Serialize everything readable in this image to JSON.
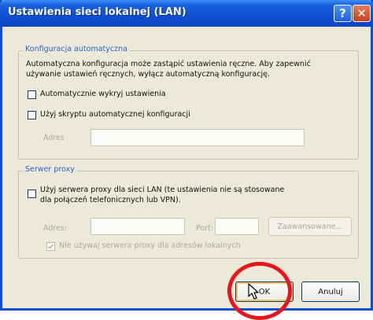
{
  "window": {
    "title": "Ustawienia sieci lokalnej (LAN)",
    "help_glyph": "?",
    "close_glyph": "✕"
  },
  "auto_config": {
    "legend": "Konfiguracja automatyczna",
    "description_line1": "Automatyczna konfiguracja może zastąpić ustawienia ręczne. Aby zapewnić",
    "description_line2": "używanie ustawień ręcznych, wyłącz automatyczną konfigurację.",
    "detect_label": "Automatycznie wykryj ustawienia",
    "detect_checked": false,
    "script_label": "Użyj skryptu automatycznej konfiguracji",
    "script_checked": false,
    "address_label": "Adres",
    "address_value": ""
  },
  "proxy": {
    "legend": "Serwer proxy",
    "use_proxy_line1": "Użyj serwera proxy dla sieci LAN (te ustawienia nie są stosowane",
    "use_proxy_line2": "dla połączeń telefonicznych lub VPN).",
    "use_proxy_checked": false,
    "address_label": "Adres:",
    "address_value": "",
    "port_label": "Port:",
    "port_value": "",
    "advanced_label": "Zaawansowane...",
    "bypass_label": "Nie używaj serwera proxy dla adresów lokalnych",
    "bypass_checked": true
  },
  "buttons": {
    "ok_label": "OK",
    "cancel_label": "Anuluj"
  },
  "colors": {
    "titlebar": "#0f4ed1",
    "highlight_circle": "#e8161c"
  }
}
